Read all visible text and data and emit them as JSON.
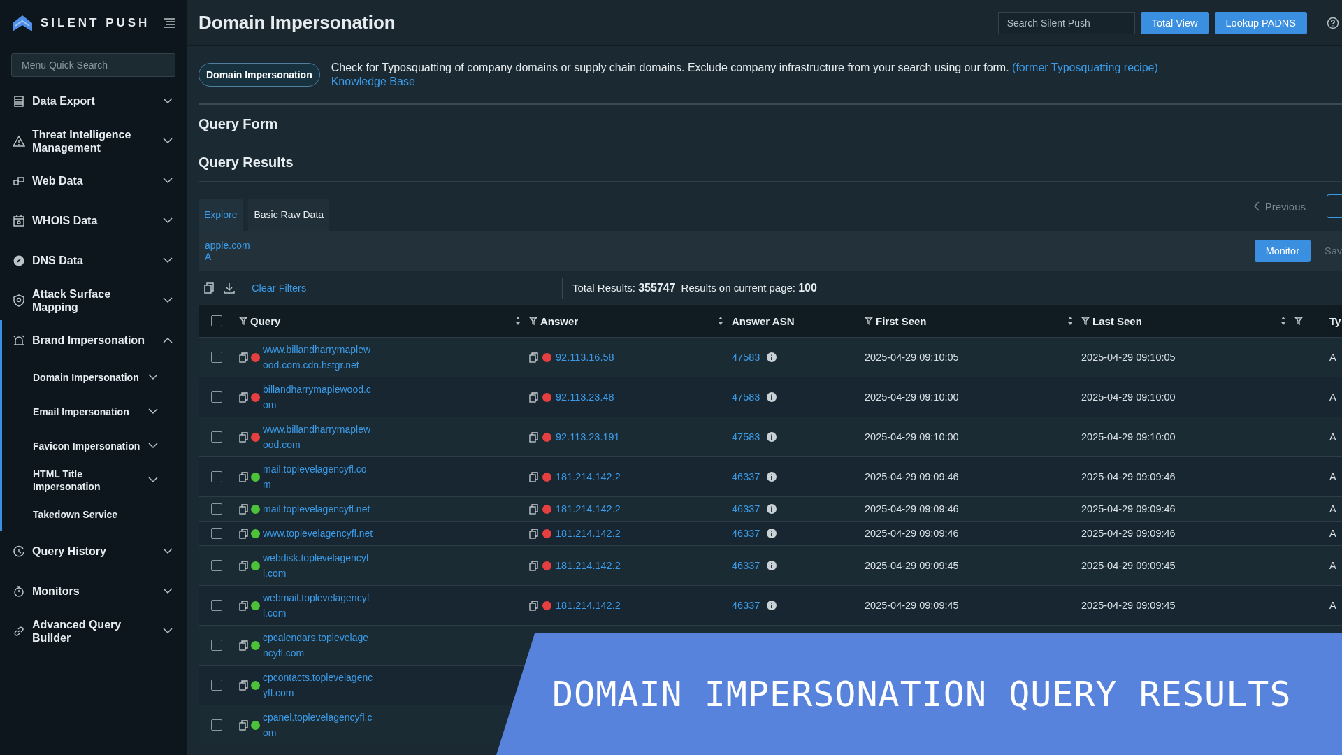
{
  "sidebar": {
    "brand": "SILENT PUSH",
    "search": {
      "placeholder": "Menu Quick Search"
    },
    "items": [
      {
        "label": "Data Export",
        "expanded": false
      },
      {
        "label": "Threat Intelligence Management",
        "expanded": false
      },
      {
        "label": "Web Data",
        "expanded": false
      },
      {
        "label": "WHOIS Data",
        "expanded": false
      },
      {
        "label": "DNS Data",
        "expanded": false
      },
      {
        "label": "Attack Surface Mapping",
        "expanded": false
      },
      {
        "label": "Brand Impersonation",
        "expanded": true,
        "children": [
          {
            "label": "Domain Impersonation",
            "kind": "group"
          },
          {
            "label": "Email Impersonation",
            "kind": "group"
          },
          {
            "label": "Favicon Impersonation",
            "kind": "group"
          },
          {
            "label": "HTML Title Impersonation",
            "kind": "group"
          },
          {
            "label": "Takedown Service",
            "kind": "link"
          }
        ]
      },
      {
        "label": "Query History",
        "expanded": false
      },
      {
        "label": "Monitors",
        "expanded": false
      },
      {
        "label": "Advanced Query Builder",
        "expanded": false
      }
    ]
  },
  "header": {
    "title": "Domain Impersonation",
    "search": {
      "placeholder": "Search Silent Push"
    },
    "buttons": [
      "Total View",
      "Lookup PADNS"
    ]
  },
  "description": {
    "pill": "Domain Impersonation",
    "text": "Check for Typosquatting of company domains or supply chain domains. Exclude company infrastructure from your search using our form. ",
    "link": "(former Typosquatting recipe)",
    "kb_link": "Knowledge Base"
  },
  "sections": [
    "Query Form",
    "Query Results"
  ],
  "tabs": [
    {
      "label": "Explore",
      "selected": true
    },
    {
      "label": "Basic Raw Data",
      "selected": false
    }
  ],
  "pagination": {
    "previous": "Previous"
  },
  "filters": [
    "apple.com",
    "A"
  ],
  "actions": {
    "monitor": "Monitor",
    "save": "Sav"
  },
  "toolbar": {
    "clear": "Clear Filters",
    "total": "Total Results: **355747**",
    "page": "Results on current page: **100**"
  },
  "table": {
    "select_all": {
      "checked": false
    },
    "columns": [
      {
        "label": "Query",
        "filter": true,
        "sort": true
      },
      {
        "label": "Answer",
        "filter": true,
        "sort": true
      },
      {
        "label": "Answer ASN",
        "filter": false,
        "sort": false
      },
      {
        "label": "First Seen",
        "filter": true,
        "sort": true
      },
      {
        "label": "Last Seen",
        "filter": true,
        "sort": true
      },
      {
        "filter": true,
        "sort": false
      },
      {
        "label": "Ty",
        "filter": false,
        "sort": false
      }
    ],
    "rows": [
      {
        "checked": false,
        "query": "www.billandharrymaplewood.com.cdn.hstgr.net",
        "query_dot": {
          "color": "#e5403f"
        },
        "answer": "92.113.16.58",
        "answer_dot": {
          "color": "#e5403f"
        },
        "asn": "47583",
        "first_seen": "2025-04-29 09:10:05",
        "last_seen": "2025-04-29 09:10:05",
        "type": "A"
      },
      {
        "checked": false,
        "query": "billandharrymaplewood.com",
        "query_dot": {
          "color": "#e5403f"
        },
        "answer": "92.113.23.48",
        "answer_dot": {
          "color": "#e5403f"
        },
        "asn": "47583",
        "first_seen": "2025-04-29 09:10:00",
        "last_seen": "2025-04-29 09:10:00",
        "type": "A"
      },
      {
        "checked": false,
        "query": "www.billandharrymaplewood.com",
        "query_dot": {
          "color": "#e5403f"
        },
        "answer": "92.113.23.191",
        "answer_dot": {
          "color": "#e5403f"
        },
        "asn": "47583",
        "first_seen": "2025-04-29 09:10:00",
        "last_seen": "2025-04-29 09:10:00",
        "type": "A"
      },
      {
        "checked": false,
        "query": "mail.toplevelagencyfl.com",
        "query_dot": {
          "color": "#4cc13a"
        },
        "answer": "181.214.142.2",
        "answer_dot": {
          "color": "#e5403f"
        },
        "asn": "46337",
        "first_seen": "2025-04-29 09:09:46",
        "last_seen": "2025-04-29 09:09:46",
        "type": "A"
      },
      {
        "checked": false,
        "query": "mail.toplevelagencyfl.net",
        "query_dot": {
          "color": "#4cc13a"
        },
        "answer": "181.214.142.2",
        "answer_dot": {
          "color": "#e5403f"
        },
        "asn": "46337",
        "first_seen": "2025-04-29 09:09:46",
        "last_seen": "2025-04-29 09:09:46",
        "type": "A"
      },
      {
        "checked": false,
        "query": "www.toplevelagencyfl.net",
        "query_dot": {
          "color": "#4cc13a"
        },
        "answer": "181.214.142.2",
        "answer_dot": {
          "color": "#e5403f"
        },
        "asn": "46337",
        "first_seen": "2025-04-29 09:09:46",
        "last_seen": "2025-04-29 09:09:46",
        "type": "A"
      },
      {
        "checked": false,
        "query": "webdisk.toplevelagencyfl.com",
        "query_dot": {
          "color": "#4cc13a"
        },
        "answer": "181.214.142.2",
        "answer_dot": {
          "color": "#e5403f"
        },
        "asn": "46337",
        "first_seen": "2025-04-29 09:09:45",
        "last_seen": "2025-04-29 09:09:45",
        "type": "A"
      },
      {
        "checked": false,
        "query": "webmail.toplevelagencyfl.com",
        "query_dot": {
          "color": "#4cc13a"
        },
        "answer": "181.214.142.2",
        "answer_dot": {
          "color": "#e5403f"
        },
        "asn": "46337",
        "first_seen": "2025-04-29 09:09:45",
        "last_seen": "2025-04-29 09:09:45",
        "type": "A"
      },
      {
        "checked": false,
        "query": "cpcalendars.toplevelagencyfl.com",
        "query_dot": {
          "color": "#4cc13a"
        }
      },
      {
        "checked": false,
        "query": "cpcontacts.toplevelagencyfl.com",
        "query_dot": {
          "color": "#4cc13a"
        }
      },
      {
        "checked": false,
        "query": "cpanel.toplevelagencyfl.com",
        "query_dot": {
          "color": "#4cc13a"
        }
      }
    ]
  },
  "banner": {
    "text": "DOMAIN IMPERSONATION QUERY RESULTS"
  }
}
